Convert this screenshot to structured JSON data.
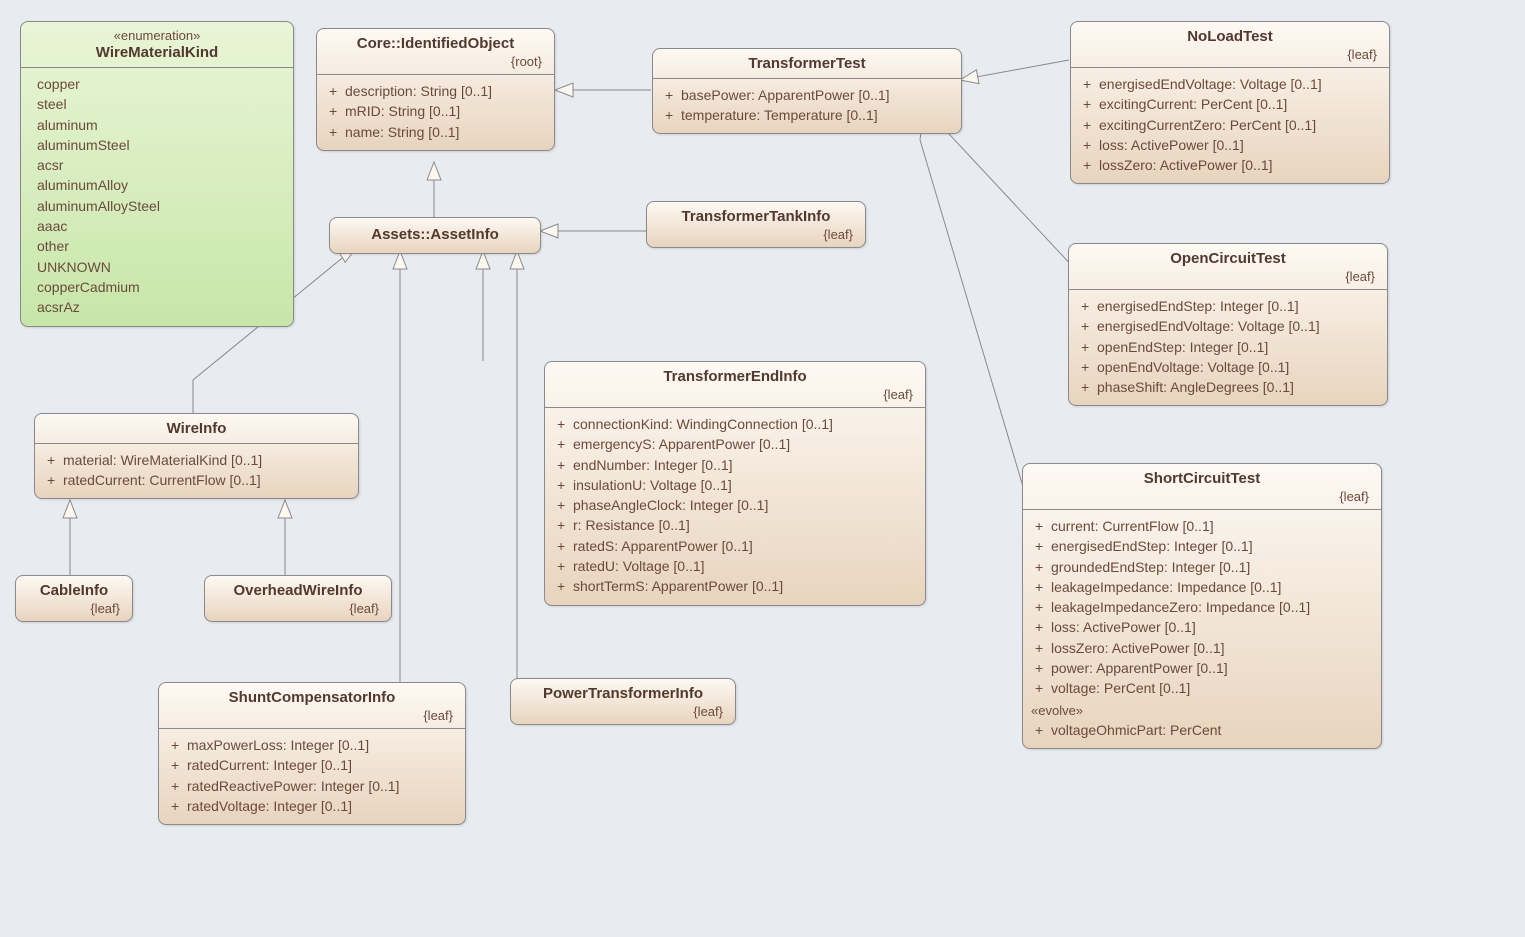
{
  "classes": {
    "WireMaterialKind": {
      "stereotype": "«enumeration»",
      "name": "WireMaterialKind",
      "items": [
        "copper",
        "steel",
        "aluminum",
        "aluminumSteel",
        "acsr",
        "aluminumAlloy",
        "aluminumAlloySteel",
        "aaac",
        "other",
        "UNKNOWN",
        "copperCadmium",
        "acsrAz"
      ]
    },
    "IdentifiedObject": {
      "name": "Core::IdentifiedObject",
      "constraint": "{root}",
      "attrs": [
        "description: String [0..1]",
        "mRID: String [0..1]",
        "name: String [0..1]"
      ]
    },
    "TransformerTest": {
      "name": "TransformerTest",
      "attrs": [
        "basePower: ApparentPower [0..1]",
        "temperature: Temperature [0..1]"
      ]
    },
    "NoLoadTest": {
      "name": "NoLoadTest",
      "constraint": "{leaf}",
      "attrs": [
        "energisedEndVoltage: Voltage [0..1]",
        "excitingCurrent: PerCent [0..1]",
        "excitingCurrentZero: PerCent [0..1]",
        "loss: ActivePower [0..1]",
        "lossZero: ActivePower [0..1]"
      ]
    },
    "AssetInfo": {
      "name": "Assets::AssetInfo"
    },
    "TransformerTankInfo": {
      "name": "TransformerTankInfo",
      "constraint": "{leaf}"
    },
    "OpenCircuitTest": {
      "name": "OpenCircuitTest",
      "constraint": "{leaf}",
      "attrs": [
        "energisedEndStep: Integer [0..1]",
        "energisedEndVoltage: Voltage [0..1]",
        "openEndStep: Integer [0..1]",
        "openEndVoltage: Voltage [0..1]",
        "phaseShift: AngleDegrees [0..1]"
      ]
    },
    "TransformerEndInfo": {
      "name": "TransformerEndInfo",
      "constraint": "{leaf}",
      "attrs": [
        "connectionKind: WindingConnection [0..1]",
        "emergencyS: ApparentPower [0..1]",
        "endNumber: Integer [0..1]",
        "insulationU: Voltage [0..1]",
        "phaseAngleClock: Integer [0..1]",
        "r: Resistance [0..1]",
        "ratedS: ApparentPower [0..1]",
        "ratedU: Voltage [0..1]",
        "shortTermS: ApparentPower [0..1]"
      ]
    },
    "WireInfo": {
      "name": "WireInfo",
      "attrs": [
        "material: WireMaterialKind [0..1]",
        "ratedCurrent: CurrentFlow [0..1]"
      ]
    },
    "CableInfo": {
      "name": "CableInfo",
      "constraint": "{leaf}"
    },
    "OverheadWireInfo": {
      "name": "OverheadWireInfo",
      "constraint": "{leaf}"
    },
    "ShortCircuitTest": {
      "name": "ShortCircuitTest",
      "constraint": "{leaf}",
      "attrs": [
        "current: CurrentFlow [0..1]",
        "energisedEndStep: Integer [0..1]",
        "groundedEndStep: Integer [0..1]",
        "leakageImpedance: Impedance [0..1]",
        "leakageImpedanceZero: Impedance [0..1]",
        "loss: ActivePower [0..1]",
        "lossZero: ActivePower [0..1]",
        "power: ApparentPower [0..1]",
        "voltage: PerCent [0..1]"
      ],
      "evolveStereo": "«evolve»",
      "evolveAttrs": [
        "voltageOhmicPart: PerCent"
      ]
    },
    "ShuntCompensatorInfo": {
      "name": "ShuntCompensatorInfo",
      "constraint": "{leaf}",
      "attrs": [
        "maxPowerLoss: Integer [0..1]",
        "ratedCurrent: Integer [0..1]",
        "ratedReactivePower: Integer [0..1]",
        "ratedVoltage: Integer [0..1]"
      ]
    },
    "PowerTransformerInfo": {
      "name": "PowerTransformerInfo",
      "constraint": "{leaf}"
    }
  }
}
